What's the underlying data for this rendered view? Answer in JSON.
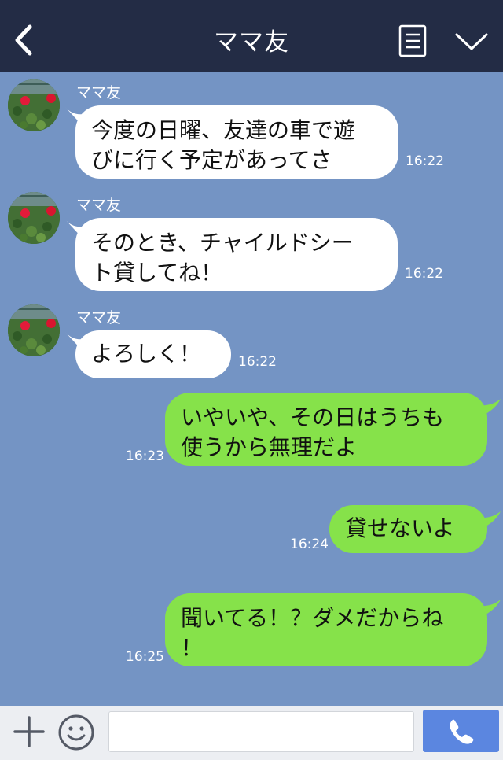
{
  "header": {
    "title": "ママ友",
    "back_icon": "chevron-left-icon",
    "menu_icon": "document-lines-icon",
    "collapse_icon": "chevron-down-icon",
    "background": "#232c45"
  },
  "chat": {
    "background": "#7494c4",
    "incoming_bubble_color": "#ffffff",
    "outgoing_bubble_color": "#86e24a",
    "messages": [
      {
        "direction": "incoming",
        "sender": "ママ友",
        "lines": [
          "今度の日曜、友達の車で遊",
          "びに行く予定があってさ"
        ],
        "time": "16:22"
      },
      {
        "direction": "incoming",
        "sender": "ママ友",
        "lines": [
          "そのとき、チャイルドシー",
          "ト貸してね！"
        ],
        "time": "16:22"
      },
      {
        "direction": "incoming",
        "sender": "ママ友",
        "lines": [
          "よろしく！"
        ],
        "time": "16:22"
      },
      {
        "direction": "outgoing",
        "lines": [
          "いやいや、その日はうちも",
          "使うから無理だよ"
        ],
        "time": "16:23"
      },
      {
        "direction": "outgoing",
        "lines": [
          "貸せないよ"
        ],
        "time": "16:24"
      },
      {
        "direction": "outgoing",
        "lines": [
          "聞いてる！？ダメだからね",
          "！"
        ],
        "time": "16:25"
      }
    ]
  },
  "footer": {
    "plus_icon": "plus-icon",
    "emoji_icon": "smiley-icon",
    "input_value": "",
    "call_icon": "phone-icon",
    "call_button_color": "#5b86e0"
  }
}
